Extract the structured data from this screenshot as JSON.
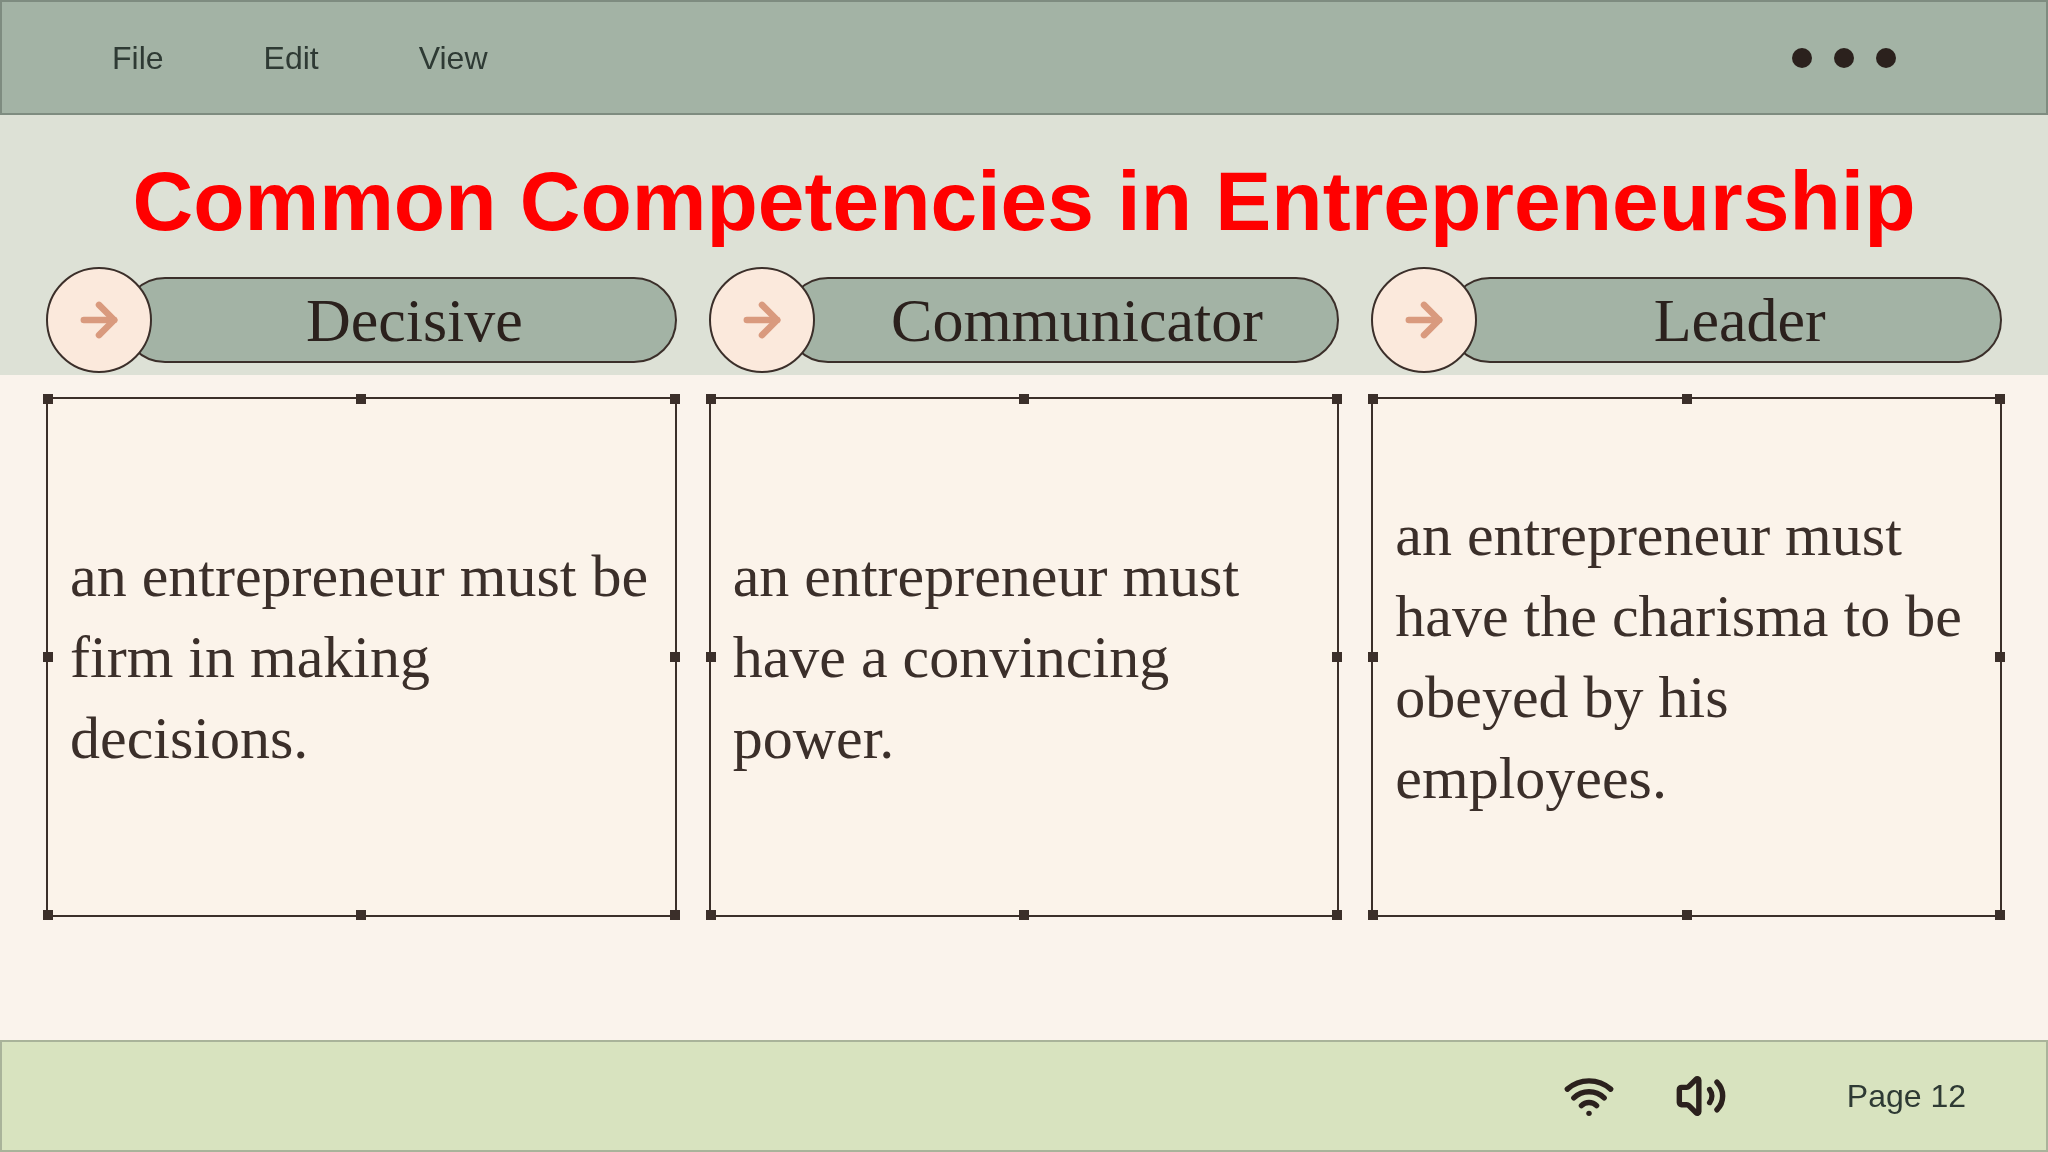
{
  "menu": [
    "File",
    "Edit",
    "View"
  ],
  "slide": {
    "title": "Common Competencies in Entrepreneurship",
    "cards": [
      {
        "heading": "Decisive",
        "text": "an entrepreneur must be firm in making decisions."
      },
      {
        "heading": "Communicator",
        "text": "an entrepreneur must have a convincing power."
      },
      {
        "heading": "Leader",
        "text": "an entrepreneur must have the charisma to be obeyed by his employees."
      }
    ]
  },
  "status_bar": {
    "page": "Page 12"
  }
}
